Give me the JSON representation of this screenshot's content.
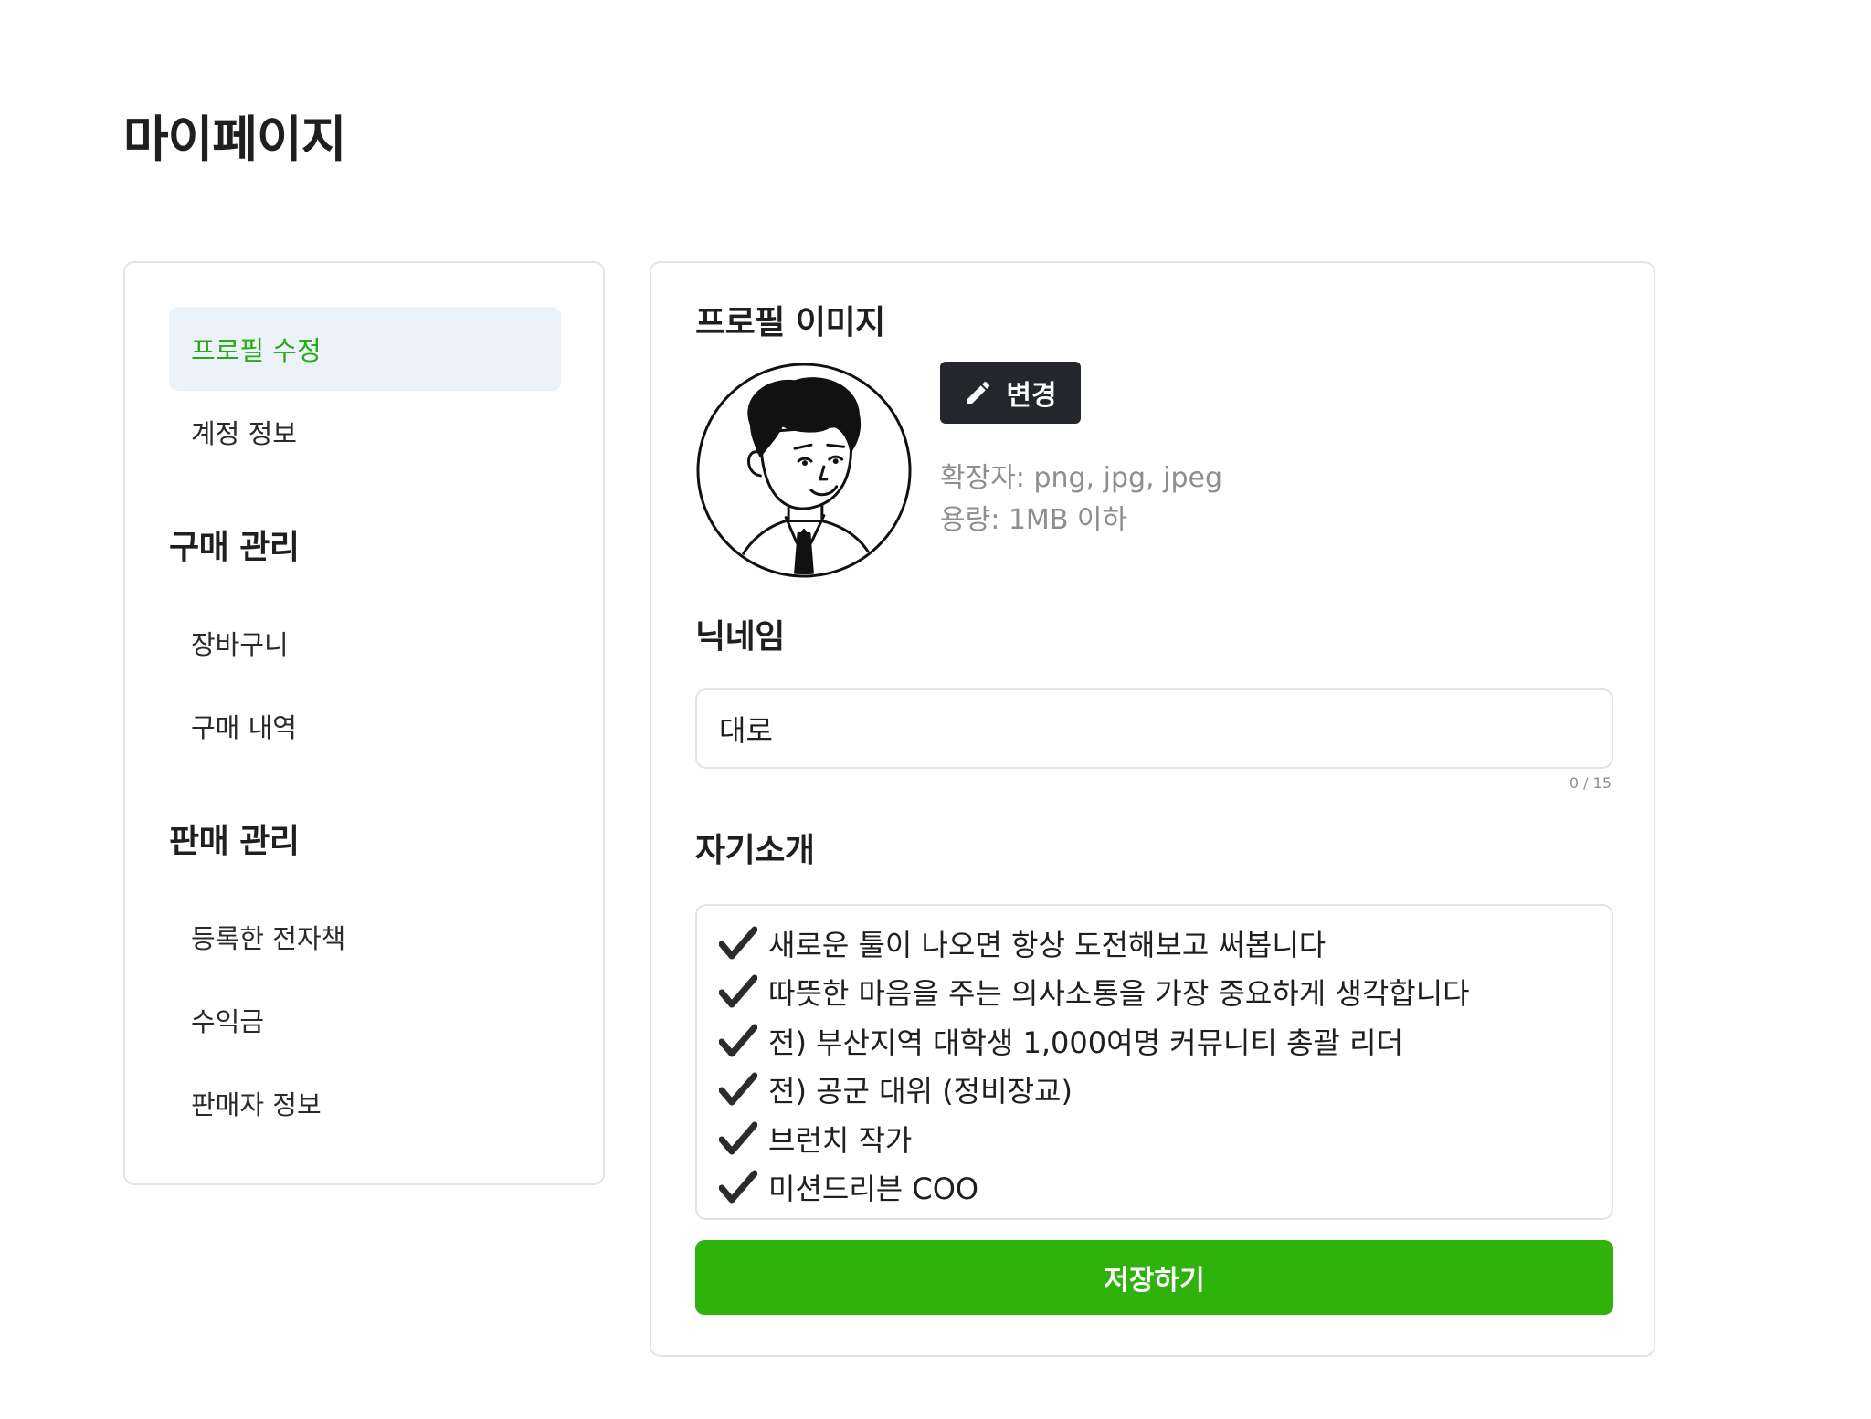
{
  "page": {
    "title": "마이페이지"
  },
  "sidebar": {
    "items": [
      {
        "label": "프로필 수정",
        "active": true
      },
      {
        "label": "계정 정보"
      }
    ],
    "purchase": {
      "heading": "구매 관리",
      "items": [
        {
          "label": "장바구니"
        },
        {
          "label": "구매 내역"
        }
      ]
    },
    "sales": {
      "heading": "판매 관리",
      "items": [
        {
          "label": "등록한 전자책"
        },
        {
          "label": "수익금"
        },
        {
          "label": "판매자 정보"
        }
      ]
    }
  },
  "profile": {
    "image_title": "프로필 이미지",
    "change_button": "변경",
    "change_icon": "pencil-icon",
    "ext_hint": "확장자: png, jpg, jpeg",
    "size_hint": "용량: 1MB 이하",
    "nickname_title": "닉네임",
    "nickname_value": "대로",
    "nickname_counter": "0 / 15",
    "bio_title": "자기소개",
    "bio_icon": "check-icon",
    "bio_lines": [
      "새로운 툴이 나오면 항상 도전해보고 써봅니다",
      "따뜻한 마음을 주는 의사소통을 가장 중요하게 생각합니다",
      "전) 부산지역 대학생 1,000여명 커뮤니티 총괄 리더",
      "전) 공군 대위 (정비장교)",
      "브런치 작가",
      "미션드리븐 COO"
    ],
    "save_button": "저장하기"
  },
  "colors": {
    "accent": "#2fb20c",
    "active_text": "#2aab14",
    "active_bg": "#ecf2f9",
    "dark_button": "#23272b",
    "border": "#e3e3e3",
    "muted": "#8e8e8e"
  }
}
